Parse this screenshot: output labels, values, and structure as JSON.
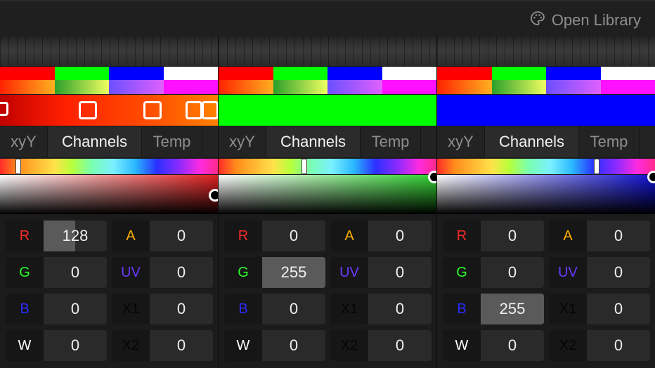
{
  "toolbar": {
    "open_library_label": "Open Library",
    "open_library_icon": "palette-icon"
  },
  "swatches": {
    "row1": [
      "#ff0000",
      "#00ff00",
      "#0000ff",
      "#ffffff"
    ],
    "colors": {
      "accent_red": "#ff0000",
      "accent_green": "#00ff00",
      "accent_blue": "#0000ff"
    }
  },
  "tabs": [
    "xyY",
    "Channels",
    "Temp"
  ],
  "channel_labels": {
    "r": "R",
    "g": "G",
    "b": "B",
    "w": "W",
    "a": "A",
    "uv": "UV",
    "x1": "X1",
    "x2": "X2"
  },
  "channel_colors": {
    "r": "#ff2a2a",
    "g": "#2aff2a",
    "b": "#2a2aff",
    "w": "#ffffff",
    "a": "#ffb000",
    "uv": "#6a3aff",
    "x1": "#1c1c1c",
    "x2": "#1c1c1c"
  },
  "panels": [
    {
      "color": "#ff0000",
      "active_tab": "Channels",
      "values": {
        "r": "128",
        "g": "0",
        "b": "0",
        "w": "0",
        "a": "0",
        "uv": "0",
        "x1": "0",
        "x2": "0"
      },
      "highlight_fraction": {
        "r": 0.5
      }
    },
    {
      "color": "#00ff00",
      "active_tab": "Channels",
      "values": {
        "r": "0",
        "g": "255",
        "b": "0",
        "w": "0",
        "a": "0",
        "uv": "0",
        "x1": "0",
        "x2": "0"
      },
      "highlight_fraction": {
        "g": 1.0
      }
    },
    {
      "color": "#0000ff",
      "active_tab": "Channels",
      "values": {
        "r": "0",
        "g": "0",
        "b": "255",
        "w": "0",
        "a": "0",
        "uv": "0",
        "x1": "0",
        "x2": "0"
      },
      "highlight_fraction": {
        "b": 1.0
      }
    }
  ]
}
